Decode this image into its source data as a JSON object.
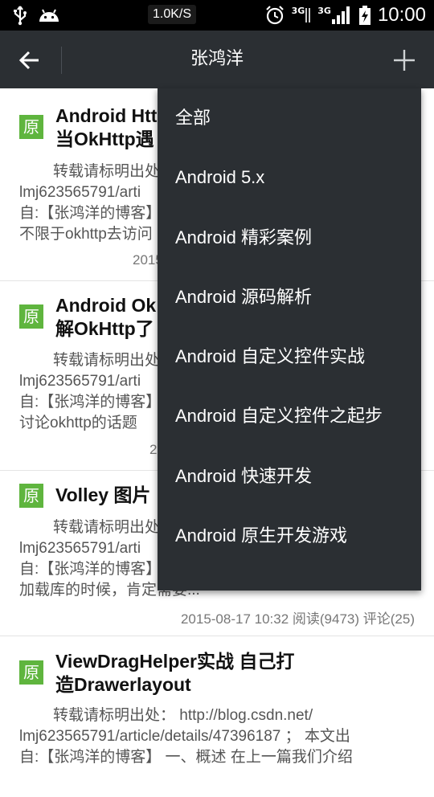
{
  "status_bar": {
    "speed": "1.0K/S",
    "signal_label_1": "3G",
    "signal_label_2": "3G",
    "time": "10:00"
  },
  "appbar": {
    "title": "张鸿洋"
  },
  "articles": [
    {
      "badge": "原",
      "title_1": "Android Http",
      "title_2": "当OkHttp遇",
      "summary_1": "转载请标明出处",
      "summary_2": "lmj623565791/arti",
      "summary_3": "自:【张鸿洋的博客】",
      "summary_4": "不限于okhttp去访问",
      "meta": "2015"
    },
    {
      "badge": "原",
      "title_1": "Android Ok",
      "title_2": "解OkHttp了",
      "summary_1": "转载请标明出处",
      "summary_2": "lmj623565791/arti",
      "summary_3": "自:【张鸿洋的博客】",
      "summary_4": "讨论okhttp的话题",
      "meta": "2"
    },
    {
      "badge": "原",
      "title_1": "Volley 图片",
      "summary_1": "转载请标明出处",
      "summary_2": "lmj623565791/arti",
      "summary_3": "自:【张鸿洋的博客】",
      "summary_4": "加载库的时候，肯定需要...",
      "meta": "2015-08-17 10:32 阅读(9473) 评论(25)"
    },
    {
      "badge": "原",
      "title_1": "ViewDragHelper实战 自己打",
      "title_2": "造Drawerlayout",
      "summary_1": "转载请标明出处： http://blog.csdn.net/",
      "summary_2": "lmj623565791/article/details/47396187 ； 本文出",
      "summary_3": "自:【张鸿洋的博客】 一、概述 在上一篇我们介绍"
    }
  ],
  "menu": {
    "items": [
      "全部",
      "Android 5.x",
      "Android 精彩案例",
      "Android 源码解析",
      "Android 自定义控件实战",
      "Android 自定义控件之起步",
      "Android 快速开发",
      "Android 原生开发游戏"
    ]
  },
  "colors": {
    "appbar": "#2b2f33",
    "badge": "#5fb53e"
  }
}
